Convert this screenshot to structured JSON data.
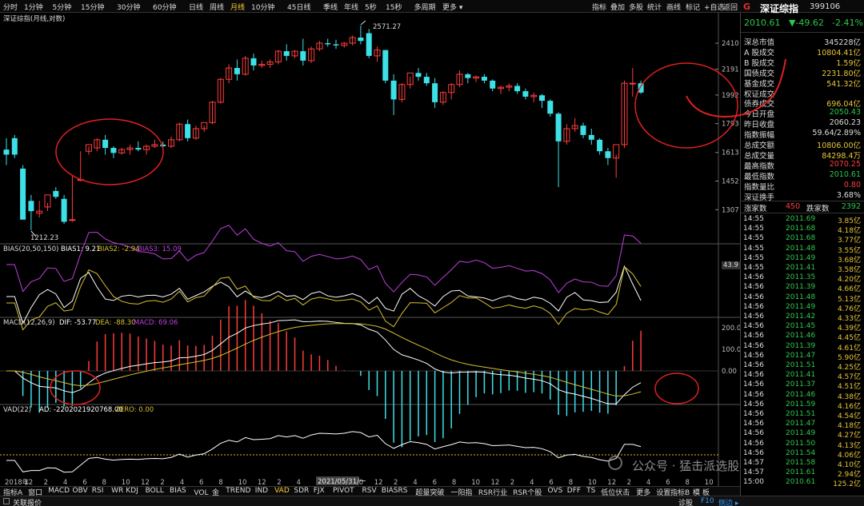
{
  "toolbar": {
    "timeframes": [
      "分时",
      "1分钟",
      "5分钟",
      "15分钟",
      "30分钟",
      "60分钟",
      "日线",
      "周线",
      "月线",
      "10分钟",
      "45日线",
      "季线",
      "年线",
      "5秒",
      "15秒",
      "多周期",
      "更多 ▾"
    ],
    "active_timeframe": "月线",
    "tools": [
      "指标",
      "叠加",
      "多股",
      "统计",
      "画线",
      "标记",
      "+自选",
      "返回"
    ]
  },
  "main_chart": {
    "title": "深证综指(月线,对数)",
    "high_label": "2571.27",
    "low_label": "1212.23",
    "price_ticks": [
      "2410",
      "2191",
      "1992",
      "1793",
      "1613",
      "1452",
      "1307"
    ],
    "x_labels": [
      "2018年",
      "12",
      "2",
      "4",
      "6",
      "8",
      "10",
      "12",
      "2",
      "4",
      "6",
      "8",
      "10",
      "12",
      "2",
      "4",
      "6",
      "8",
      "10",
      "12",
      "2",
      "4",
      "6",
      "8",
      "10",
      "12",
      "2",
      "4",
      "6",
      "8",
      "10",
      "12",
      "2",
      "4",
      "6",
      "8",
      "10"
    ],
    "x_marker": "2021/05/31/一"
  },
  "bias": {
    "title": "BIAS(20,50,150)",
    "b1": "BIAS1: 9.21",
    "b2": "BIAS2: -2.94",
    "b3": "BIAS3: 15.09",
    "tick": "43.9"
  },
  "macd": {
    "title": "MACD(12,26,9)",
    "dif": "DIF: -53.77",
    "dea": "DEA: -88.30",
    "macd": "MACD: 69.06",
    "ticks": [
      "200.0",
      "100.0",
      "0.00"
    ]
  },
  "vad": {
    "title": "VAD(22)",
    "ad": "AD: -2202021920768.00",
    "zero": "ZERO: 0.00",
    "watermark": "公众号 · 猛击派选股"
  },
  "bottom_tabs": [
    "指标A",
    "窗口",
    "MACD",
    "OBV",
    "RSI",
    "WR",
    "KDJ",
    "BOLL",
    "BIAS",
    "VOL_金",
    "TREND",
    "IND",
    "VAD",
    "SDR",
    "FJX",
    "PIVOT",
    "RSV",
    "BIASRS",
    "超量突破",
    "一阳指",
    "RSR行业",
    "RSR个股",
    "OVS",
    "DFF",
    "TS",
    "低位伏击",
    "更多",
    "设置"
  ],
  "bottom_right_tabs": [
    "指标B",
    "模 板"
  ],
  "status_bar": {
    "left": "关联报价",
    "items": [
      "诊股",
      "F10",
      "侧边 ▸"
    ]
  },
  "side_panel": {
    "name": "深证综指",
    "code": "399106",
    "price": "2010.61",
    "change": "▼-49.62",
    "pct": "-2.41%",
    "stats": [
      {
        "label": "深总市值",
        "value": "345228亿",
        "color": "#dddddd"
      },
      {
        "label": "A 股成交",
        "value": "10804.41亿",
        "color": "#e8c63a"
      },
      {
        "label": "B 股成交",
        "value": "1.59亿",
        "color": "#e8c63a"
      },
      {
        "label": "国债成交",
        "value": "2231.80亿",
        "color": "#e8c63a"
      },
      {
        "label": "基金成交",
        "value": "541.32亿",
        "color": "#e8c63a"
      },
      {
        "label": "权证成交",
        "value": "",
        "color": "#e8c63a"
      },
      {
        "label": "债券成交",
        "value": "696.04亿",
        "color": "#e8c63a"
      },
      {
        "label": "今日开盘",
        "value": "2050.43",
        "color": "#2ec84a"
      },
      {
        "label": "昨日收盘",
        "value": "2060.23",
        "color": "#dddddd"
      },
      {
        "label": "指数振幅",
        "value": "59.64/2.89%",
        "color": "#dddddd"
      },
      {
        "label": "总成交额",
        "value": "10806.00亿",
        "color": "#e8c63a"
      },
      {
        "label": "总成交量",
        "value": "84298.4万",
        "color": "#e8c63a"
      },
      {
        "label": "最高指数",
        "value": "2070.25",
        "color": "#ff3c3c"
      },
      {
        "label": "最低指数",
        "value": "2010.61",
        "color": "#2ec84a"
      },
      {
        "label": "指数量比",
        "value": "0.80",
        "color": "#ff3c3c"
      },
      {
        "label": "深证换手",
        "value": "3.68%",
        "color": "#dddddd"
      }
    ],
    "updown": {
      "up_label": "涨家数",
      "up": "450",
      "down_label": "跌家数",
      "down": "2392"
    },
    "ticks": [
      {
        "t": "14:55",
        "p": "2011.69",
        "v": "3.85亿"
      },
      {
        "t": "14:55",
        "p": "2011.68",
        "v": "4.18亿"
      },
      {
        "t": "14:55",
        "p": "2011.68",
        "v": "3.77亿"
      },
      {
        "t": "14:55",
        "p": "2011.48",
        "v": "3.55亿"
      },
      {
        "t": "14:55",
        "p": "2011.49",
        "v": "3.68亿"
      },
      {
        "t": "14:55",
        "p": "2011.41",
        "v": "3.58亿"
      },
      {
        "t": "14:56",
        "p": "2011.35",
        "v": "4.20亿"
      },
      {
        "t": "14:56",
        "p": "2011.39",
        "v": "4.66亿"
      },
      {
        "t": "14:56",
        "p": "2011.48",
        "v": "5.13亿"
      },
      {
        "t": "14:56",
        "p": "2011.49",
        "v": "4.76亿"
      },
      {
        "t": "14:56",
        "p": "2011.42",
        "v": "4.33亿"
      },
      {
        "t": "14:56",
        "p": "2011.45",
        "v": "4.39亿"
      },
      {
        "t": "14:56",
        "p": "2011.46",
        "v": "4.45亿"
      },
      {
        "t": "14:56",
        "p": "2011.39",
        "v": "4.61亿"
      },
      {
        "t": "14:56",
        "p": "2011.47",
        "v": "5.90亿"
      },
      {
        "t": "14:56",
        "p": "2011.51",
        "v": "4.25亿"
      },
      {
        "t": "14:56",
        "p": "2011.41",
        "v": "4.57亿"
      },
      {
        "t": "14:56",
        "p": "2011.37",
        "v": "4.51亿"
      },
      {
        "t": "14:56",
        "p": "2011.46",
        "v": "4.38亿"
      },
      {
        "t": "14:56",
        "p": "2011.59",
        "v": "4.16亿"
      },
      {
        "t": "14:56",
        "p": "2011.51",
        "v": "4.54亿"
      },
      {
        "t": "14:56",
        "p": "2011.47",
        "v": "4.18亿"
      },
      {
        "t": "14:56",
        "p": "2011.49",
        "v": "4.27亿"
      },
      {
        "t": "14:56",
        "p": "2011.50",
        "v": "4.13亿"
      },
      {
        "t": "14:56",
        "p": "2011.54",
        "v": "4.06亿"
      },
      {
        "t": "14:57",
        "p": "2011.58",
        "v": "4.10亿"
      },
      {
        "t": "14:57",
        "p": "2011.61",
        "v": "2.94亿"
      },
      {
        "t": "15:00",
        "p": "2010.61",
        "v": "125.2亿"
      }
    ]
  },
  "candles": [
    [
      1630,
      1700,
      1600,
      1540
    ],
    [
      1700,
      1720,
      1600,
      1580
    ],
    [
      1520,
      1540,
      1260,
      1300
    ],
    [
      1350,
      1380,
      1300,
      1212
    ],
    [
      1290,
      1350,
      1300,
      1270
    ],
    [
      1320,
      1340,
      1380,
      1300
    ],
    [
      1400,
      1420,
      1370,
      1360
    ],
    [
      1360,
      1380,
      1250,
      1240
    ],
    [
      1260,
      1480,
      1260,
      1250
    ],
    [
      1460,
      1620,
      1460,
      1450
    ],
    [
      1620,
      1650,
      1660,
      1600
    ],
    [
      1640,
      1700,
      1690,
      1620
    ],
    [
      1690,
      1720,
      1640,
      1600
    ],
    [
      1640,
      1650,
      1610,
      1580
    ],
    [
      1610,
      1640,
      1630,
      1600
    ],
    [
      1630,
      1660,
      1640,
      1600
    ],
    [
      1640,
      1680,
      1630,
      1620
    ],
    [
      1630,
      1660,
      1650,
      1600
    ],
    [
      1650,
      1690,
      1660,
      1640
    ],
    [
      1660,
      1680,
      1650,
      1640
    ],
    [
      1650,
      1710,
      1690,
      1640
    ],
    [
      1690,
      1800,
      1790,
      1680
    ],
    [
      1790,
      1820,
      1700,
      1680
    ],
    [
      1700,
      1780,
      1760,
      1690
    ],
    [
      1760,
      1780,
      1800,
      1740
    ],
    [
      1800,
      1950,
      1940,
      1790
    ],
    [
      1940,
      2120,
      2110,
      1930
    ],
    [
      2110,
      2230,
      2200,
      2080
    ],
    [
      2200,
      2270,
      2150,
      2100
    ],
    [
      2150,
      2300,
      2280,
      2140
    ],
    [
      2280,
      2320,
      2220,
      2180
    ],
    [
      2220,
      2260,
      2230,
      2200
    ],
    [
      2230,
      2270,
      2250,
      2200
    ],
    [
      2250,
      2350,
      2340,
      2230
    ],
    [
      2340,
      2400,
      2300,
      2260
    ],
    [
      2300,
      2350,
      2340,
      2280
    ],
    [
      2340,
      2450,
      2260,
      2220
    ],
    [
      2260,
      2380,
      2360,
      2240
    ],
    [
      2360,
      2430,
      2410,
      2340
    ],
    [
      2410,
      2450,
      2400,
      2380
    ],
    [
      2400,
      2440,
      2390,
      2360
    ],
    [
      2390,
      2420,
      2410,
      2370
    ],
    [
      2410,
      2480,
      2460,
      2390
    ],
    [
      2460,
      2571,
      2430,
      2400
    ],
    [
      2500,
      2540,
      2300,
      2280
    ],
    [
      2300,
      2380,
      2350,
      2250
    ],
    [
      2350,
      2300,
      2100,
      2080
    ],
    [
      2100,
      2150,
      1960,
      1850
    ],
    [
      1960,
      2080,
      2070,
      1940
    ],
    [
      2070,
      2130,
      2160,
      2040
    ],
    [
      2160,
      2200,
      2130,
      2100
    ],
    [
      2130,
      2160,
      2080,
      2060
    ],
    [
      2080,
      2120,
      1940,
      1900
    ],
    [
      1940,
      2020,
      2010,
      1920
    ],
    [
      2010,
      2080,
      2070,
      1960
    ],
    [
      2070,
      2180,
      2150,
      2050
    ],
    [
      2150,
      2160,
      2120,
      2080
    ],
    [
      2120,
      2140,
      2130,
      2090
    ],
    [
      2130,
      2150,
      2100,
      2080
    ],
    [
      2100,
      2110,
      2040,
      2020
    ],
    [
      2040,
      2060,
      2050,
      2000
    ],
    [
      2050,
      2080,
      2060,
      2020
    ],
    [
      2060,
      2080,
      2020,
      2000
    ],
    [
      2020,
      2040,
      1980,
      1960
    ],
    [
      1980,
      2010,
      1990,
      1940
    ],
    [
      1990,
      2000,
      1950,
      1900
    ],
    [
      1950,
      1960,
      1860,
      1840
    ],
    [
      1860,
      1870,
      1680,
      1420
    ],
    [
      1680,
      1790,
      1760,
      1660
    ],
    [
      1760,
      1830,
      1780,
      1740
    ],
    [
      1780,
      1800,
      1720,
      1700
    ],
    [
      1720,
      1760,
      1690,
      1660
    ],
    [
      1690,
      1700,
      1620,
      1600
    ],
    [
      1620,
      1640,
      1580,
      1540
    ],
    [
      1580,
      1600,
      1660,
      1470
    ],
    [
      1660,
      2100,
      2080,
      1640
    ],
    [
      2080,
      2200,
      2080,
      1980
    ],
    [
      2080,
      2100,
      2010,
      2000
    ]
  ],
  "colors": {
    "up": "#ff3c3c",
    "down": "#3ee0e8",
    "white": "#ffffff",
    "yellow": "#d8c030",
    "magenta": "#c040e0",
    "annot": "#e02020"
  }
}
